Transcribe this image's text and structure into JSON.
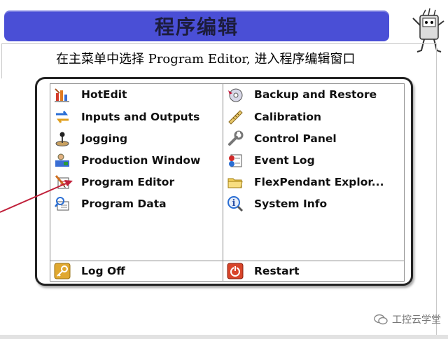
{
  "slide": {
    "title": "程序编辑",
    "caption": "在主菜单中选择 Program Editor, 进入程序编辑窗口"
  },
  "menu": {
    "left_items": [
      {
        "label": "HotEdit",
        "icon": "hotedit-icon"
      },
      {
        "label": "Inputs and Outputs",
        "icon": "inputs-outputs-icon"
      },
      {
        "label": "Jogging",
        "icon": "joystick-icon"
      },
      {
        "label": "Production Window",
        "icon": "production-window-icon"
      },
      {
        "label": "Program Editor",
        "icon": "program-editor-icon"
      },
      {
        "label": "Program Data",
        "icon": "program-data-icon"
      }
    ],
    "right_items": [
      {
        "label": "Backup and Restore",
        "icon": "backup-restore-icon"
      },
      {
        "label": "Calibration",
        "icon": "calibration-icon"
      },
      {
        "label": "Control Panel",
        "icon": "control-panel-icon"
      },
      {
        "label": "Event Log",
        "icon": "event-log-icon"
      },
      {
        "label": "FlexPendant Explor...",
        "icon": "folder-icon"
      },
      {
        "label": "System Info",
        "icon": "system-info-icon"
      }
    ],
    "footer": {
      "log_off": "Log Off",
      "restart": "Restart"
    }
  },
  "watermark": {
    "text": "工控云学堂"
  },
  "colors": {
    "title_bar": "#4a4fd6",
    "arrow": "#c0203a"
  }
}
